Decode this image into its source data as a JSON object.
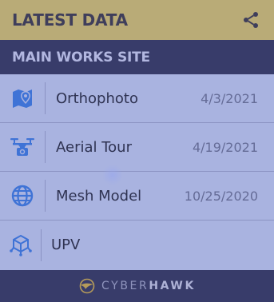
{
  "header": {
    "title": "LATEST DATA",
    "share_icon": "share-icon"
  },
  "site": {
    "title": "MAIN WORKS SITE"
  },
  "items": [
    {
      "label": "Orthophoto",
      "date": "4/3/2021",
      "icon": "map-pin-icon"
    },
    {
      "label": "Aerial Tour",
      "date": "4/19/2021",
      "icon": "drone-icon"
    },
    {
      "label": "Mesh Model",
      "date": "10/25/2020",
      "icon": "globe-icon"
    },
    {
      "label": "UPV",
      "date": "",
      "icon": "cube-network-icon"
    }
  ],
  "footer": {
    "brand_light": "CYBER",
    "brand_bold": "HAWK",
    "logo_icon": "hawk-logo-icon"
  },
  "colors": {
    "header_bg": "#b9ab77",
    "navy": "#383c6a",
    "panel_bg": "#a9b3e0",
    "icon_blue": "#3f73d6"
  }
}
